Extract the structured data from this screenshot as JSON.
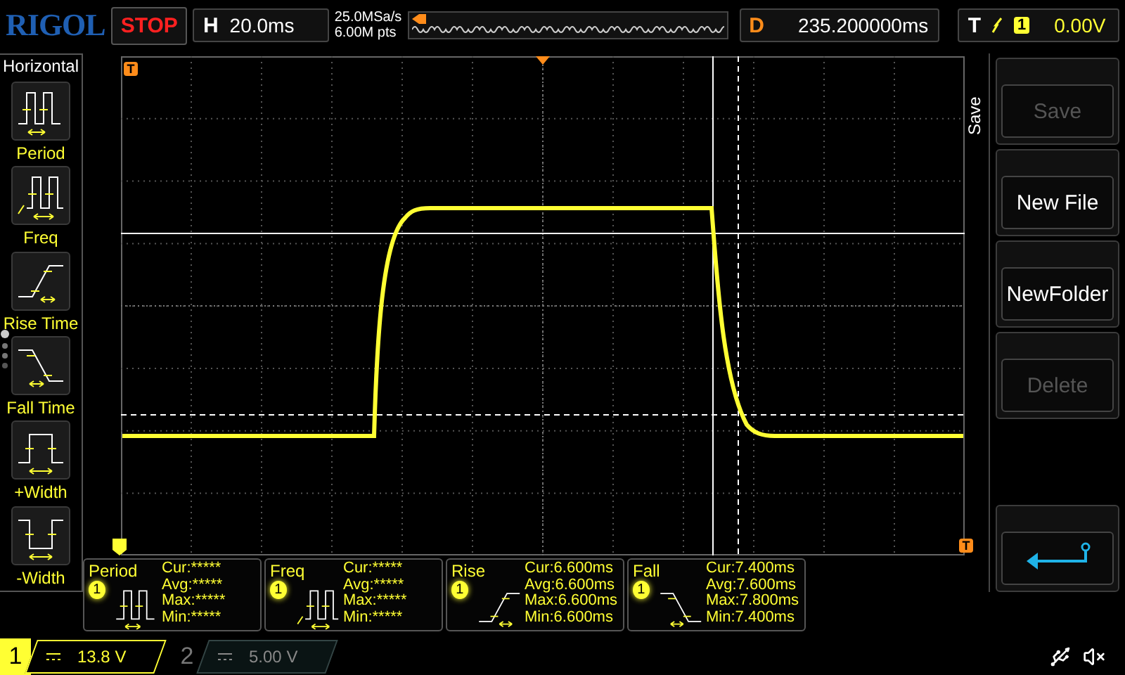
{
  "header": {
    "brand": "RIGOL",
    "run_state": "STOP",
    "timebase": {
      "label": "H",
      "value": "20.0ms"
    },
    "sample_rate": "25.0MSa/s",
    "memory_depth": "6.00M pts",
    "delay": {
      "label": "D",
      "value": "235.200000ms"
    },
    "trigger": {
      "label": "T",
      "channel": "1",
      "level": "0.00V"
    }
  },
  "menu": {
    "title": "Horizontal",
    "items": [
      {
        "label": "Period",
        "kind": "period"
      },
      {
        "label": "Freq",
        "kind": "freq"
      },
      {
        "label": "Rise Time",
        "kind": "rise"
      },
      {
        "label": "Fall Time",
        "kind": "fall"
      },
      {
        "label": "+Width",
        "kind": "pwidth"
      },
      {
        "label": "-Width",
        "kind": "nwidth"
      }
    ]
  },
  "plot": {
    "trigger_marker": "T",
    "trigger_level_marker": "T"
  },
  "measurements": [
    {
      "name": "Period",
      "channel": "1",
      "kind": "period",
      "readings": [
        "Cur:*****",
        "Avg:*****",
        "Max:*****",
        "Min:*****"
      ]
    },
    {
      "name": "Freq",
      "channel": "1",
      "kind": "freq",
      "readings": [
        "Cur:*****",
        "Avg:*****",
        "Max:*****",
        "Min:*****"
      ]
    },
    {
      "name": "Rise",
      "channel": "1",
      "kind": "rise",
      "readings": [
        "Cur:6.600ms",
        "Avg:6.600ms",
        "Max:6.600ms",
        "Min:6.600ms"
      ]
    },
    {
      "name": "Fall",
      "channel": "1",
      "kind": "fall",
      "readings": [
        "Cur:7.400ms",
        "Avg:7.600ms",
        "Max:7.800ms",
        "Min:7.400ms"
      ]
    }
  ],
  "side_menu": {
    "title": "Save",
    "buttons": [
      {
        "kind": "text",
        "label": "Save",
        "disabled": true
      },
      {
        "kind": "text",
        "label": "New File",
        "disabled": false
      },
      {
        "kind": "text",
        "label": "NewFolder",
        "disabled": false
      },
      {
        "kind": "text",
        "label": "Delete",
        "disabled": true
      },
      {
        "kind": "spacer"
      },
      {
        "kind": "back",
        "disabled": false
      }
    ]
  },
  "channels": [
    {
      "number": "1",
      "scale": "13.8 V",
      "on": true
    },
    {
      "number": "2",
      "scale": "5.00 V",
      "on": false
    }
  ]
}
